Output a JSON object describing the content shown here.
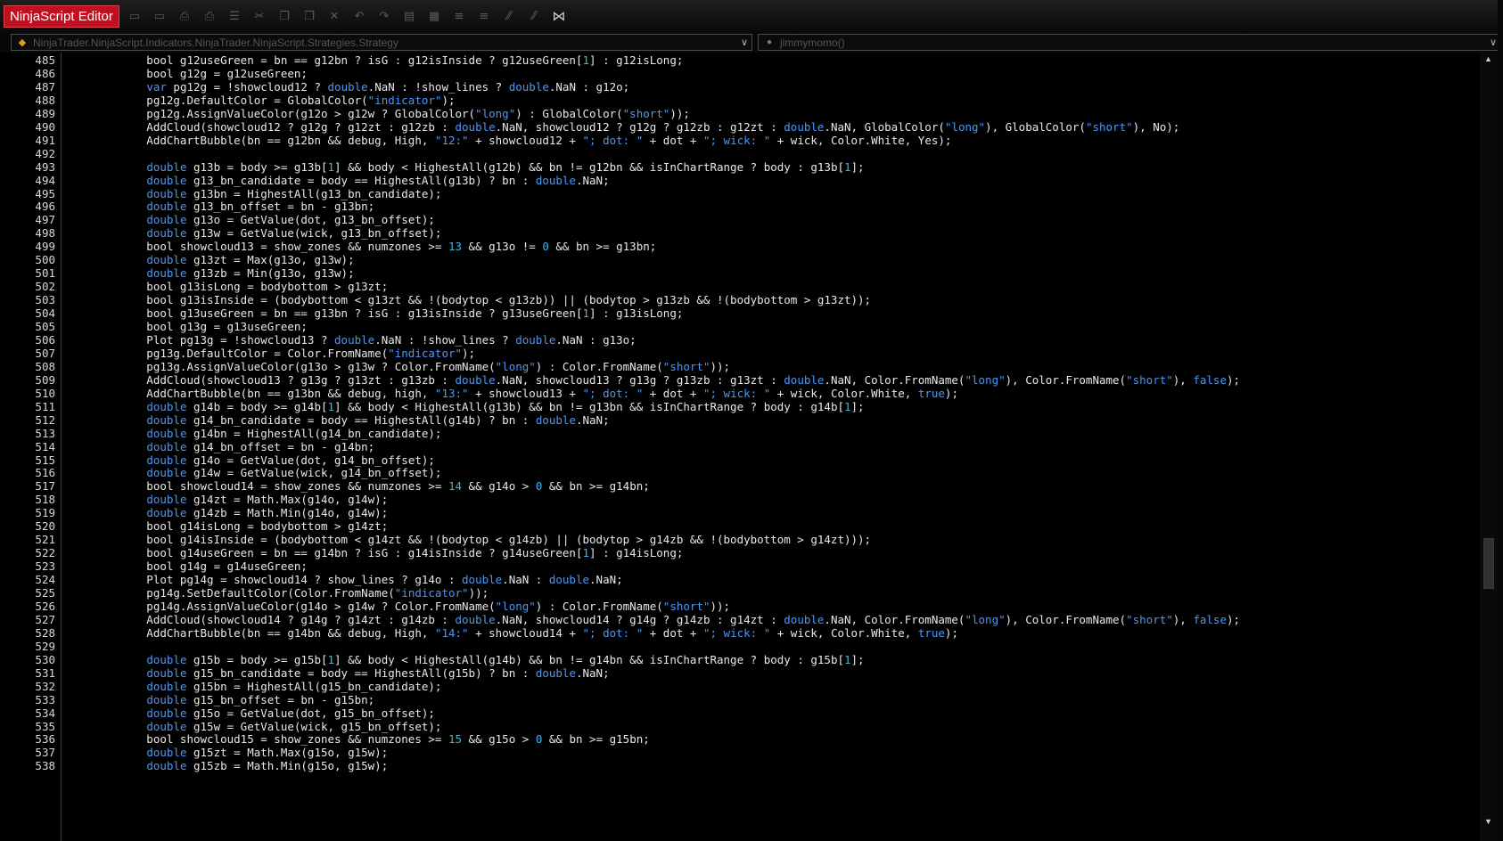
{
  "app": {
    "title": "NinjaScript Editor"
  },
  "toolbar": {
    "icons": [
      "save-icon",
      "save-all-icon",
      "print-icon",
      "print-preview-icon",
      "properties-icon",
      "cut-icon",
      "copy-icon",
      "paste-icon",
      "delete-icon",
      "undo-icon",
      "redo-icon",
      "compile-icon",
      "template-icon",
      "indent-icon",
      "outdent-icon",
      "comment-icon",
      "uncomment-icon",
      "visual-studio-icon"
    ]
  },
  "selectors": {
    "class_path": "NinjaTrader.NinjaScript.Indicators.NinjaTrader.NinjaScript.Strategies.Strategy",
    "member": "jimmymomo()"
  },
  "editor": {
    "first_line": 485,
    "lines": [
      [
        [
          "p",
          "            bool g12useGreen = bn == g12bn ? isG : g12isInside ? g12useGreen["
        ],
        [
          "n",
          "1"
        ],
        [
          "p",
          "] : g12isLong;"
        ]
      ],
      [
        [
          "p",
          "            bool g12g = g12useGreen;"
        ]
      ],
      [
        [
          "p",
          "            "
        ],
        [
          "k",
          "var"
        ],
        [
          "p",
          " pg12g = !showcloud12 ? "
        ],
        [
          "k",
          "double"
        ],
        [
          "p",
          ".NaN : !show_lines ? "
        ],
        [
          "k",
          "double"
        ],
        [
          "p",
          ".NaN : g12o;"
        ]
      ],
      [
        [
          "p",
          "            pg12g.DefaultColor = GlobalColor("
        ],
        [
          "s",
          "\"indicator\""
        ],
        [
          "p",
          ");"
        ]
      ],
      [
        [
          "p",
          "            pg12g.AssignValueColor(g12o > g12w ? GlobalColor("
        ],
        [
          "s",
          "\"long\""
        ],
        [
          "p",
          ") : GlobalColor("
        ],
        [
          "s",
          "\"short\""
        ],
        [
          "p",
          "));"
        ]
      ],
      [
        [
          "p",
          "            AddCloud(showcloud12 ? g12g ? g12zt : g12zb : "
        ],
        [
          "k",
          "double"
        ],
        [
          "p",
          ".NaN, showcloud12 ? g12g ? g12zb : g12zt : "
        ],
        [
          "k",
          "double"
        ],
        [
          "p",
          ".NaN, GlobalColor("
        ],
        [
          "s",
          "\"long\""
        ],
        [
          "p",
          "), GlobalColor("
        ],
        [
          "s",
          "\"short\""
        ],
        [
          "p",
          "), No);"
        ]
      ],
      [
        [
          "p",
          "            AddChartBubble(bn == g12bn && debug, High, "
        ],
        [
          "s",
          "\"12:\""
        ],
        [
          "p",
          " + showcloud12 + "
        ],
        [
          "s",
          "\"; dot: \""
        ],
        [
          "p",
          " + dot + "
        ],
        [
          "s",
          "\"; wick: \""
        ],
        [
          "p",
          " + wick, Color.White, Yes);"
        ]
      ],
      [],
      [
        [
          "p",
          "            "
        ],
        [
          "k",
          "double"
        ],
        [
          "p",
          " g13b = body >= g13b["
        ],
        [
          "n",
          "1"
        ],
        [
          "p",
          "] && body < HighestAll(g12b) && bn != g12bn && isInChartRange ? body : g13b["
        ],
        [
          "n",
          "1"
        ],
        [
          "p",
          "];"
        ]
      ],
      [
        [
          "p",
          "            "
        ],
        [
          "k",
          "double"
        ],
        [
          "p",
          " g13_bn_candidate = body == HighestAll(g13b) ? bn : "
        ],
        [
          "k",
          "double"
        ],
        [
          "p",
          ".NaN;"
        ]
      ],
      [
        [
          "p",
          "            "
        ],
        [
          "k",
          "double"
        ],
        [
          "p",
          " g13bn = HighestAll(g13_bn_candidate);"
        ]
      ],
      [
        [
          "p",
          "            "
        ],
        [
          "k",
          "double"
        ],
        [
          "p",
          " g13_bn_offset = bn - g13bn;"
        ]
      ],
      [
        [
          "p",
          "            "
        ],
        [
          "k",
          "double"
        ],
        [
          "p",
          " g13o = GetValue(dot, g13_bn_offset);"
        ]
      ],
      [
        [
          "p",
          "            "
        ],
        [
          "k",
          "double"
        ],
        [
          "p",
          " g13w = GetValue(wick, g13_bn_offset);"
        ]
      ],
      [
        [
          "p",
          "            bool showcloud13 = show_zones && numzones >= "
        ],
        [
          "n",
          "13"
        ],
        [
          "p",
          " && g13o != "
        ],
        [
          "n",
          "0"
        ],
        [
          "p",
          " && bn >= g13bn;"
        ]
      ],
      [
        [
          "p",
          "            "
        ],
        [
          "k",
          "double"
        ],
        [
          "p",
          " g13zt = Max(g13o, g13w);"
        ]
      ],
      [
        [
          "p",
          "            "
        ],
        [
          "k",
          "double"
        ],
        [
          "p",
          " g13zb = Min(g13o, g13w);"
        ]
      ],
      [
        [
          "p",
          "            bool g13isLong = bodybottom > g13zt;"
        ]
      ],
      [
        [
          "p",
          "            bool g13isInside = (bodybottom < g13zt && !(bodytop < g13zb)) || (bodytop > g13zb && !(bodybottom > g13zt));"
        ]
      ],
      [
        [
          "p",
          "            bool g13useGreen = bn == g13bn ? isG : g13isInside ? g13useGreen["
        ],
        [
          "n",
          "1"
        ],
        [
          "p",
          "] : g13isLong;"
        ]
      ],
      [
        [
          "p",
          "            bool g13g = g13useGreen;"
        ]
      ],
      [
        [
          "p",
          "            Plot pg13g = !showcloud13 ? "
        ],
        [
          "k",
          "double"
        ],
        [
          "p",
          ".NaN : !show_lines ? "
        ],
        [
          "k",
          "double"
        ],
        [
          "p",
          ".NaN : g13o;"
        ]
      ],
      [
        [
          "p",
          "            pg13g.DefaultColor = Color.FromName("
        ],
        [
          "s",
          "\"indicator\""
        ],
        [
          "p",
          ");"
        ]
      ],
      [
        [
          "p",
          "            pg13g.AssignValueColor(g13o > g13w ? Color.FromName("
        ],
        [
          "s",
          "\"long\""
        ],
        [
          "p",
          ") : Color.FromName("
        ],
        [
          "s",
          "\"short\""
        ],
        [
          "p",
          "));"
        ]
      ],
      [
        [
          "p",
          "            AddCloud(showcloud13 ? g13g ? g13zt : g13zb : "
        ],
        [
          "k",
          "double"
        ],
        [
          "p",
          ".NaN, showcloud13 ? g13g ? g13zb : g13zt : "
        ],
        [
          "k",
          "double"
        ],
        [
          "p",
          ".NaN, Color.FromName("
        ],
        [
          "s",
          "\"long\""
        ],
        [
          "p",
          "), Color.FromName("
        ],
        [
          "s",
          "\"short\""
        ],
        [
          "p",
          "), "
        ],
        [
          "k",
          "false"
        ],
        [
          "p",
          ");"
        ]
      ],
      [
        [
          "p",
          "            AddChartBubble(bn == g13bn && debug, high, "
        ],
        [
          "s",
          "\"13:\""
        ],
        [
          "p",
          " + showcloud13 + "
        ],
        [
          "s",
          "\"; dot: \""
        ],
        [
          "p",
          " + dot + "
        ],
        [
          "s",
          "\"; wick: \""
        ],
        [
          "p",
          " + wick, Color.White, "
        ],
        [
          "k",
          "true"
        ],
        [
          "p",
          ");"
        ]
      ],
      [
        [
          "p",
          "            "
        ],
        [
          "k",
          "double"
        ],
        [
          "p",
          " g14b = body >= g14b["
        ],
        [
          "n",
          "1"
        ],
        [
          "p",
          "] && body < HighestAll(g13b) && bn != g13bn && isInChartRange ? body : g14b["
        ],
        [
          "n",
          "1"
        ],
        [
          "p",
          "];"
        ]
      ],
      [
        [
          "p",
          "            "
        ],
        [
          "k",
          "double"
        ],
        [
          "p",
          " g14_bn_candidate = body == HighestAll(g14b) ? bn : "
        ],
        [
          "k",
          "double"
        ],
        [
          "p",
          ".NaN;"
        ]
      ],
      [
        [
          "p",
          "            "
        ],
        [
          "k",
          "double"
        ],
        [
          "p",
          " g14bn = HighestAll(g14_bn_candidate);"
        ]
      ],
      [
        [
          "p",
          "            "
        ],
        [
          "k",
          "double"
        ],
        [
          "p",
          " g14_bn_offset = bn - g14bn;"
        ]
      ],
      [
        [
          "p",
          "            "
        ],
        [
          "k",
          "double"
        ],
        [
          "p",
          " g14o = GetValue(dot, g14_bn_offset);"
        ]
      ],
      [
        [
          "p",
          "            "
        ],
        [
          "k",
          "double"
        ],
        [
          "p",
          " g14w = GetValue(wick, g14_bn_offset);"
        ]
      ],
      [
        [
          "p",
          "            bool showcloud14 = show_zones && numzones >= "
        ],
        [
          "n",
          "14"
        ],
        [
          "p",
          " && g14o > "
        ],
        [
          "n",
          "0"
        ],
        [
          "p",
          " && bn >= g14bn;"
        ]
      ],
      [
        [
          "p",
          "            "
        ],
        [
          "k",
          "double"
        ],
        [
          "p",
          " g14zt = Math.Max(g14o, g14w);"
        ]
      ],
      [
        [
          "p",
          "            "
        ],
        [
          "k",
          "double"
        ],
        [
          "p",
          " g14zb = Math.Min(g14o, g14w);"
        ]
      ],
      [
        [
          "p",
          "            bool g14isLong = bodybottom > g14zt;"
        ]
      ],
      [
        [
          "p",
          "            bool g14isInside = (bodybottom < g14zt && !(bodytop < g14zb) || (bodytop > g14zb && !(bodybottom > g14zt)));"
        ]
      ],
      [
        [
          "p",
          "            bool g14useGreen = bn == g14bn ? isG : g14isInside ? g14useGreen["
        ],
        [
          "n",
          "1"
        ],
        [
          "p",
          "] : g14isLong;"
        ]
      ],
      [
        [
          "p",
          "            bool g14g = g14useGreen;"
        ]
      ],
      [
        [
          "p",
          "            Plot pg14g = showcloud14 ? show_lines ? g14o : "
        ],
        [
          "k",
          "double"
        ],
        [
          "p",
          ".NaN : "
        ],
        [
          "k",
          "double"
        ],
        [
          "p",
          ".NaN;"
        ]
      ],
      [
        [
          "p",
          "            pg14g.SetDefaultColor(Color.FromName("
        ],
        [
          "s",
          "\"indicator\""
        ],
        [
          "p",
          "));"
        ]
      ],
      [
        [
          "p",
          "            pg14g.AssignValueColor(g14o > g14w ? Color.FromName("
        ],
        [
          "s",
          "\"long\""
        ],
        [
          "p",
          ") : Color.FromName("
        ],
        [
          "s",
          "\"short\""
        ],
        [
          "p",
          "));"
        ]
      ],
      [
        [
          "p",
          "            AddCloud(showcloud14 ? g14g ? g14zt : g14zb : "
        ],
        [
          "k",
          "double"
        ],
        [
          "p",
          ".NaN, showcloud14 ? g14g ? g14zb : g14zt : "
        ],
        [
          "k",
          "double"
        ],
        [
          "p",
          ".NaN, Color.FromName("
        ],
        [
          "s",
          "\"long\""
        ],
        [
          "p",
          "), Color.FromName("
        ],
        [
          "s",
          "\"short\""
        ],
        [
          "p",
          "), "
        ],
        [
          "k",
          "false"
        ],
        [
          "p",
          ");"
        ]
      ],
      [
        [
          "p",
          "            AddChartBubble(bn == g14bn && debug, High, "
        ],
        [
          "s",
          "\"14:\""
        ],
        [
          "p",
          " + showcloud14 + "
        ],
        [
          "s",
          "\"; dot: \""
        ],
        [
          "p",
          " + dot + "
        ],
        [
          "s",
          "\"; wick: \""
        ],
        [
          "p",
          " + wick, Color.White, "
        ],
        [
          "k",
          "true"
        ],
        [
          "p",
          ");"
        ]
      ],
      [],
      [
        [
          "p",
          "            "
        ],
        [
          "k",
          "double"
        ],
        [
          "p",
          " g15b = body >= g15b["
        ],
        [
          "n",
          "1"
        ],
        [
          "p",
          "] && body < HighestAll(g14b) && bn != g14bn && isInChartRange ? body : g15b["
        ],
        [
          "n",
          "1"
        ],
        [
          "p",
          "];"
        ]
      ],
      [
        [
          "p",
          "            "
        ],
        [
          "k",
          "double"
        ],
        [
          "p",
          " g15_bn_candidate = body == HighestAll(g15b) ? bn : "
        ],
        [
          "k",
          "double"
        ],
        [
          "p",
          ".NaN;"
        ]
      ],
      [
        [
          "p",
          "            "
        ],
        [
          "k",
          "double"
        ],
        [
          "p",
          " g15bn = HighestAll(g15_bn_candidate);"
        ]
      ],
      [
        [
          "p",
          "            "
        ],
        [
          "k",
          "double"
        ],
        [
          "p",
          " g15_bn_offset = bn - g15bn;"
        ]
      ],
      [
        [
          "p",
          "            "
        ],
        [
          "k",
          "double"
        ],
        [
          "p",
          " g15o = GetValue(dot, g15_bn_offset);"
        ]
      ],
      [
        [
          "p",
          "            "
        ],
        [
          "k",
          "double"
        ],
        [
          "p",
          " g15w = GetValue(wick, g15_bn_offset);"
        ]
      ],
      [
        [
          "p",
          "            bool showcloud15 = show_zones && numzones >= "
        ],
        [
          "n",
          "15"
        ],
        [
          "p",
          " && g15o > "
        ],
        [
          "n",
          "0"
        ],
        [
          "p",
          " && bn >= g15bn;"
        ]
      ],
      [
        [
          "p",
          "            "
        ],
        [
          "k",
          "double"
        ],
        [
          "p",
          " g15zt = Math.Max(g15o, g15w);"
        ]
      ],
      [
        [
          "p",
          "            "
        ],
        [
          "k",
          "double"
        ],
        [
          "p",
          " g15zb = Math.Min(g15o, g15w);"
        ]
      ]
    ]
  },
  "colors": {
    "keyword": "#4f96f0",
    "string": "#4f96f0",
    "number": "#3bb5e8",
    "text": "#e8e8e8",
    "title_bg": "#c01020"
  }
}
